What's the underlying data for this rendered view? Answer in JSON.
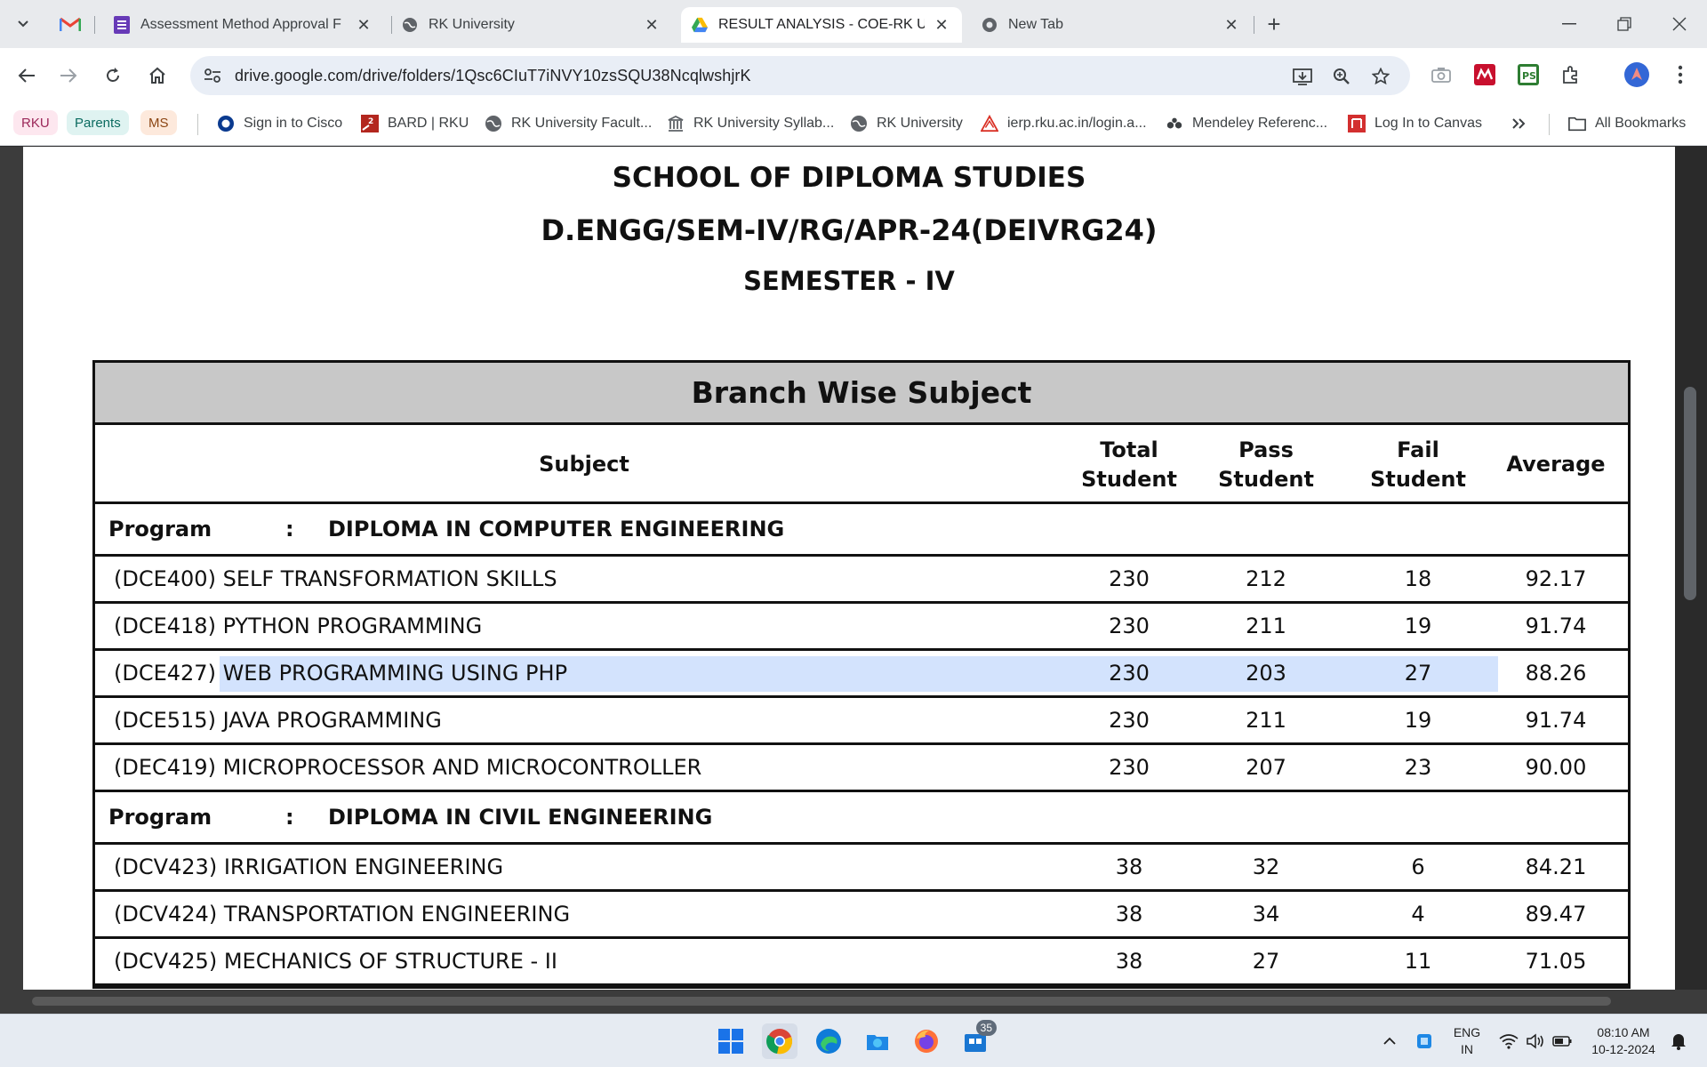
{
  "browser": {
    "tabs": [
      {
        "title": "Assessment Method Approval F",
        "active": false
      },
      {
        "title": "RK University",
        "active": false
      },
      {
        "title": "RESULT ANALYSIS - COE-RK Uni",
        "active": true
      },
      {
        "title": "New Tab",
        "active": false
      }
    ],
    "url": "drive.google.com/drive/folders/1Qsc6CIuT7iNVY10zsSQU38NcqlwshjrK",
    "bookmarks": {
      "chips": [
        "RKU",
        "Parents",
        "MS"
      ],
      "items": [
        "Sign in to Cisco",
        "BARD | RKU",
        "RK University Facult...",
        "RK University Syllab...",
        "RK University",
        "ierp.rku.ac.in/login.a...",
        "Mendeley Referenc...",
        "Log In to Canvas"
      ],
      "all_label": "All Bookmarks"
    }
  },
  "document": {
    "school": "SCHOOL OF DIPLOMA STUDIES",
    "exam": "D.ENGG/SEM-IV/RG/APR-24(DEIVRG24)",
    "semester": "SEMESTER - IV",
    "table": {
      "title": "Branch Wise Subject",
      "headers": {
        "subject": "Subject",
        "total_1": "Total",
        "total_2": "Student",
        "pass_1": "Pass",
        "pass_2": "Student",
        "fail_1": "Fail",
        "fail_2": "Student",
        "average": "Average"
      },
      "program_label": "Program",
      "program_colon": ":",
      "programs": [
        {
          "name": "DIPLOMA IN COMPUTER ENGINEERING",
          "subjects": [
            {
              "code": "(DCE400)",
              "name": "SELF TRANSFORMATION SKILLS",
              "total": "230",
              "pass": "212",
              "fail": "18",
              "average": "92.17"
            },
            {
              "code": "(DCE418)",
              "name": "PYTHON PROGRAMMING",
              "total": "230",
              "pass": "211",
              "fail": "19",
              "average": "91.74"
            },
            {
              "code": "(DCE427)",
              "name": "WEB PROGRAMMING USING PHP",
              "total": "230",
              "pass": "203",
              "fail": "27",
              "average": "88.26"
            },
            {
              "code": "(DCE515)",
              "name": "JAVA PROGRAMMING",
              "total": "230",
              "pass": "211",
              "fail": "19",
              "average": "91.74"
            },
            {
              "code": "(DEC419)",
              "name": "MICROPROCESSOR AND MICROCONTROLLER",
              "total": "230",
              "pass": "207",
              "fail": "23",
              "average": "90.00"
            }
          ]
        },
        {
          "name": "DIPLOMA IN CIVIL ENGINEERING",
          "subjects": [
            {
              "code": "(DCV423)",
              "name": "IRRIGATION ENGINEERING",
              "total": "38",
              "pass": "32",
              "fail": "6",
              "average": "84.21"
            },
            {
              "code": "(DCV424)",
              "name": "TRANSPORTATION ENGINEERING",
              "total": "38",
              "pass": "34",
              "fail": "4",
              "average": "89.47"
            },
            {
              "code": "(DCV425)",
              "name": "MECHANICS OF STRUCTURE - II",
              "total": "38",
              "pass": "27",
              "fail": "11",
              "average": "71.05"
            }
          ]
        }
      ]
    }
  },
  "taskbar": {
    "store_badge": "35",
    "lang_1": "ENG",
    "lang_2": "IN",
    "time": "08:10 AM",
    "date": "10-12-2024"
  },
  "colors": {
    "highlight": "#d3e3fd",
    "table_title_bg": "#c8c8c8",
    "active_tab": "#ffffff",
    "tabstrip": "#e8eaed"
  }
}
